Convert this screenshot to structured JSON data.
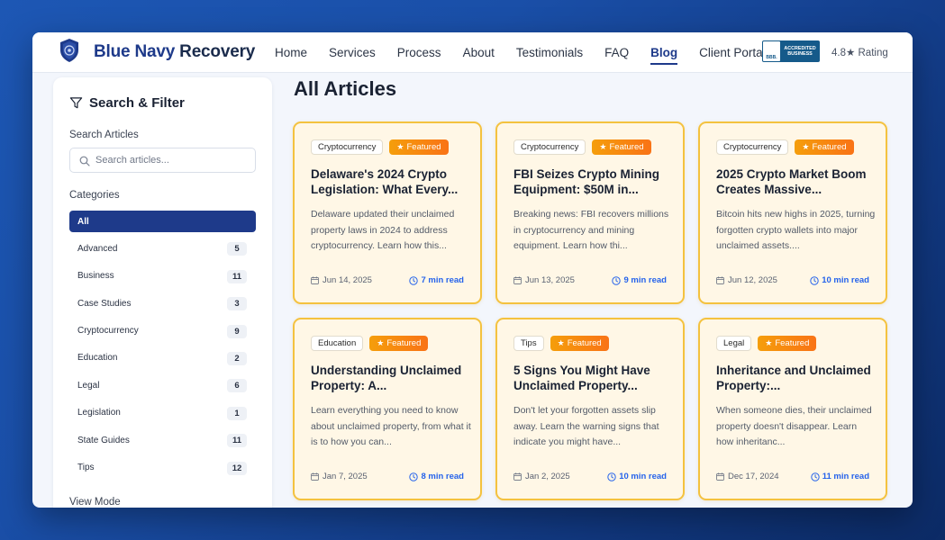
{
  "brand": {
    "name_part1": "Blue Navy",
    "name_part2": "Recovery"
  },
  "nav": {
    "items": [
      "Home",
      "Services",
      "Process",
      "About",
      "Testimonials",
      "FAQ",
      "Blog",
      "Client Portal"
    ],
    "active": "Blog"
  },
  "bbb": {
    "mark": "BBB.",
    "line1": "ACCREDITED",
    "line2": "BUSINESS"
  },
  "rating": "4.8★ Rating",
  "sidebar": {
    "title": "Search & Filter",
    "search_label": "Search Articles",
    "search_placeholder": "Search articles...",
    "search_value": "",
    "categories_label": "Categories",
    "categories": [
      {
        "name": "All",
        "count": "",
        "active": true
      },
      {
        "name": "Advanced",
        "count": "5"
      },
      {
        "name": "Business",
        "count": "11"
      },
      {
        "name": "Case Studies",
        "count": "3"
      },
      {
        "name": "Cryptocurrency",
        "count": "9"
      },
      {
        "name": "Education",
        "count": "2"
      },
      {
        "name": "Legal",
        "count": "6"
      },
      {
        "name": "Legislation",
        "count": "1"
      },
      {
        "name": "State Guides",
        "count": "11"
      },
      {
        "name": "Tips",
        "count": "12"
      }
    ],
    "view_mode_label": "View Mode"
  },
  "main": {
    "title": "All Articles"
  },
  "featured_label": "Featured",
  "articles": [
    {
      "category": "Cryptocurrency",
      "title": "Delaware's 2024 Crypto Legislation: What Every...",
      "desc": "Delaware updated their unclaimed property laws in 2024 to address cryptocurrency. Learn how this...",
      "date": "Jun 14, 2025",
      "read": "7 min read"
    },
    {
      "category": "Cryptocurrency",
      "title": "FBI Seizes Crypto Mining Equipment: $50M in...",
      "desc": "Breaking news: FBI recovers millions in cryptocurrency and mining equipment. Learn how thi...",
      "date": "Jun 13, 2025",
      "read": "9 min read"
    },
    {
      "category": "Cryptocurrency",
      "title": "2025 Crypto Market Boom Creates Massive...",
      "desc": "Bitcoin hits new highs in 2025, turning forgotten crypto wallets into major unclaimed assets....",
      "date": "Jun 12, 2025",
      "read": "10 min read"
    },
    {
      "category": "Education",
      "title": "Understanding Unclaimed Property: A...",
      "desc": "Learn everything you need to know about unclaimed property, from what it is to how you can...",
      "date": "Jan 7, 2025",
      "read": "8 min read"
    },
    {
      "category": "Tips",
      "title": "5 Signs You Might Have Unclaimed Property...",
      "desc": "Don't let your forgotten assets slip away. Learn the warning signs that indicate you might have...",
      "date": "Jan 2, 2025",
      "read": "10 min read"
    },
    {
      "category": "Legal",
      "title": "Inheritance and Unclaimed Property:...",
      "desc": "When someone dies, their unclaimed property doesn't disappear. Learn how inheritanc...",
      "date": "Dec 17, 2024",
      "read": "11 min read"
    }
  ],
  "colors": {
    "navy": "#1e3a8a",
    "featured": "#f59e0b",
    "card_border": "#f4c23f",
    "link": "#2563eb"
  }
}
